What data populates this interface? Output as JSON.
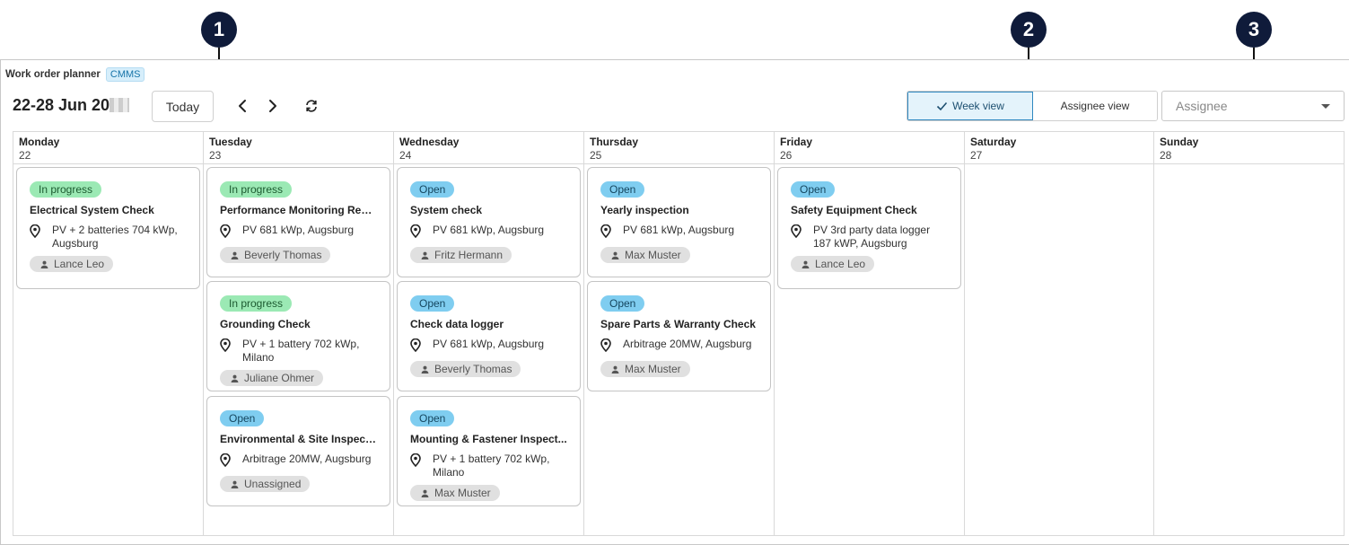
{
  "app": {
    "title": "Work order planner",
    "module_badge": "CMMS"
  },
  "toolbar": {
    "date_range": "22-28 Jun 20",
    "today_label": "Today",
    "prev_icon": "chevron-left-icon",
    "next_icon": "chevron-right-icon",
    "refresh_icon": "refresh-icon",
    "week_view_label": "Week view",
    "assignee_view_label": "Assignee view",
    "active_view": "week",
    "assignee_placeholder": "Assignee"
  },
  "markers": [
    "1",
    "2",
    "3"
  ],
  "colors": {
    "in_progress": "#9be9b4",
    "open": "#7fcdf0",
    "active_view_bg": "#e4f3fb",
    "marker": "#0f1b3a"
  },
  "days": [
    {
      "name": "Monday",
      "date": "22",
      "cards": [
        {
          "status": "In progress",
          "title": "Electrical System Check",
          "location": "PV + 2 batteries 704 kWp, Augsburg",
          "assignee": "Lance Leo"
        }
      ]
    },
    {
      "name": "Tuesday",
      "date": "23",
      "cards": [
        {
          "status": "In progress",
          "title": "Performance Monitoring Revi...",
          "location": "PV 681 kWp, Augsburg",
          "assignee": "Beverly Thomas"
        },
        {
          "status": "In progress",
          "title": "Grounding Check",
          "location": "PV + 1 battery 702 kWp, Milano",
          "assignee": "Juliane Ohmer"
        },
        {
          "status": "Open",
          "title": "Environmental & Site Inspecti...",
          "location": "Arbitrage 20MW, Augsburg",
          "assignee": "Unassigned"
        }
      ]
    },
    {
      "name": "Wednesday",
      "date": "24",
      "cards": [
        {
          "status": "Open",
          "title": "System check",
          "location": "PV 681 kWp, Augsburg",
          "assignee": "Fritz Hermann"
        },
        {
          "status": "Open",
          "title": "Check data logger",
          "location": "PV 681 kWp, Augsburg",
          "assignee": "Beverly Thomas"
        },
        {
          "status": "Open",
          "title": "Mounting & Fastener Inspect...",
          "location": "PV + 1 battery 702 kWp, Milano",
          "assignee": "Max Muster"
        }
      ]
    },
    {
      "name": "Thursday",
      "date": "25",
      "cards": [
        {
          "status": "Open",
          "title": "Yearly inspection",
          "location": "PV 681 kWp, Augsburg",
          "assignee": "Max Muster"
        },
        {
          "status": "Open",
          "title": "Spare Parts & Warranty Check",
          "location": "Arbitrage 20MW, Augsburg",
          "assignee": "Max Muster"
        }
      ]
    },
    {
      "name": "Friday",
      "date": "26",
      "cards": [
        {
          "status": "Open",
          "title": "Safety Equipment Check",
          "location": "PV 3rd party data logger 187 kWP, Augsburg",
          "assignee": "Lance Leo"
        }
      ]
    },
    {
      "name": "Saturday",
      "date": "27",
      "cards": []
    },
    {
      "name": "Sunday",
      "date": "28",
      "cards": []
    }
  ]
}
